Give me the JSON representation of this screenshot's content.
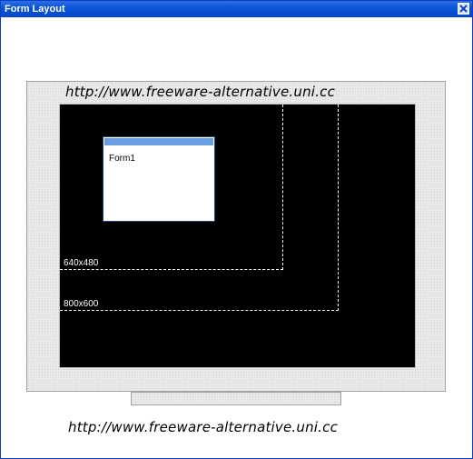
{
  "window": {
    "title": "Form Layout",
    "close_icon": "close-icon"
  },
  "monitor": {
    "header_url": "http://www.freeware-alternative.uni.cc",
    "resolutions": [
      {
        "label": "640x480"
      },
      {
        "label": "800x600"
      }
    ],
    "form": {
      "label": "Form1"
    }
  },
  "footer": {
    "url": "http://www.freeware-alternative.uni.cc"
  },
  "colors": {
    "titlebar": "#0a55d8",
    "screen": "#000000",
    "form_titlebar": "#6b9ee0"
  }
}
